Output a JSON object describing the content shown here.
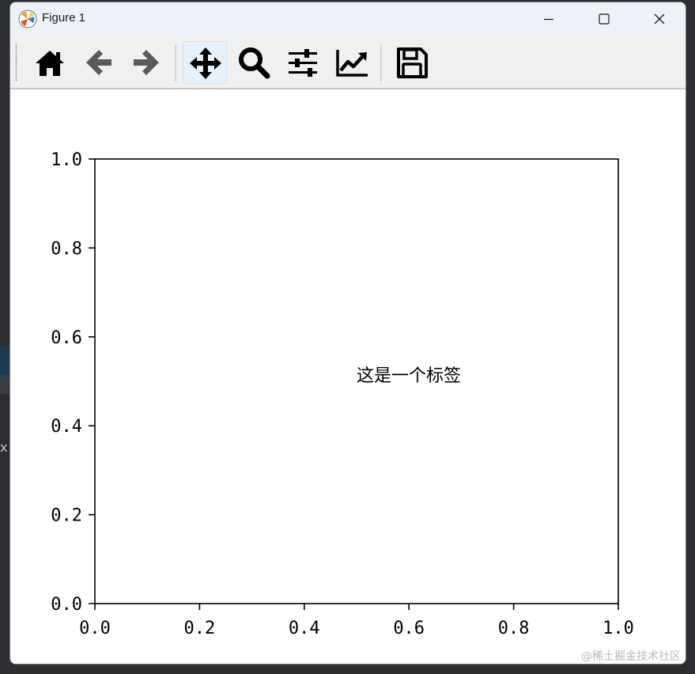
{
  "window": {
    "title": "Figure 1",
    "controls": [
      "minimize-icon",
      "maximize-icon",
      "close-icon"
    ]
  },
  "toolbar": {
    "tools": [
      {
        "name": "home",
        "icon": "home-icon",
        "active": false
      },
      {
        "name": "back",
        "icon": "arrow-left-icon",
        "active": false
      },
      {
        "name": "forward",
        "icon": "arrow-right-icon",
        "active": false
      },
      {
        "name": "pan",
        "icon": "move-icon",
        "active": true
      },
      {
        "name": "zoom",
        "icon": "magnifier-icon",
        "active": false
      },
      {
        "name": "subplots",
        "icon": "sliders-icon",
        "active": false
      },
      {
        "name": "edit-axis",
        "icon": "line-chart-icon",
        "active": false
      },
      {
        "name": "save",
        "icon": "save-icon",
        "active": false
      }
    ]
  },
  "chart_data": {
    "type": "scatter",
    "title": "",
    "xlabel": "",
    "ylabel": "",
    "xlim": [
      0.0,
      1.0
    ],
    "ylim": [
      0.0,
      1.0
    ],
    "xticks": [
      "0.0",
      "0.2",
      "0.4",
      "0.6",
      "0.8",
      "1.0"
    ],
    "yticks": [
      "0.0",
      "0.2",
      "0.4",
      "0.6",
      "0.8",
      "1.0"
    ],
    "grid": false,
    "series": [],
    "annotations": [
      {
        "text": "这是一个标签",
        "x": 0.5,
        "y": 0.5
      }
    ]
  },
  "watermark": "@稀土掘金技术社区"
}
